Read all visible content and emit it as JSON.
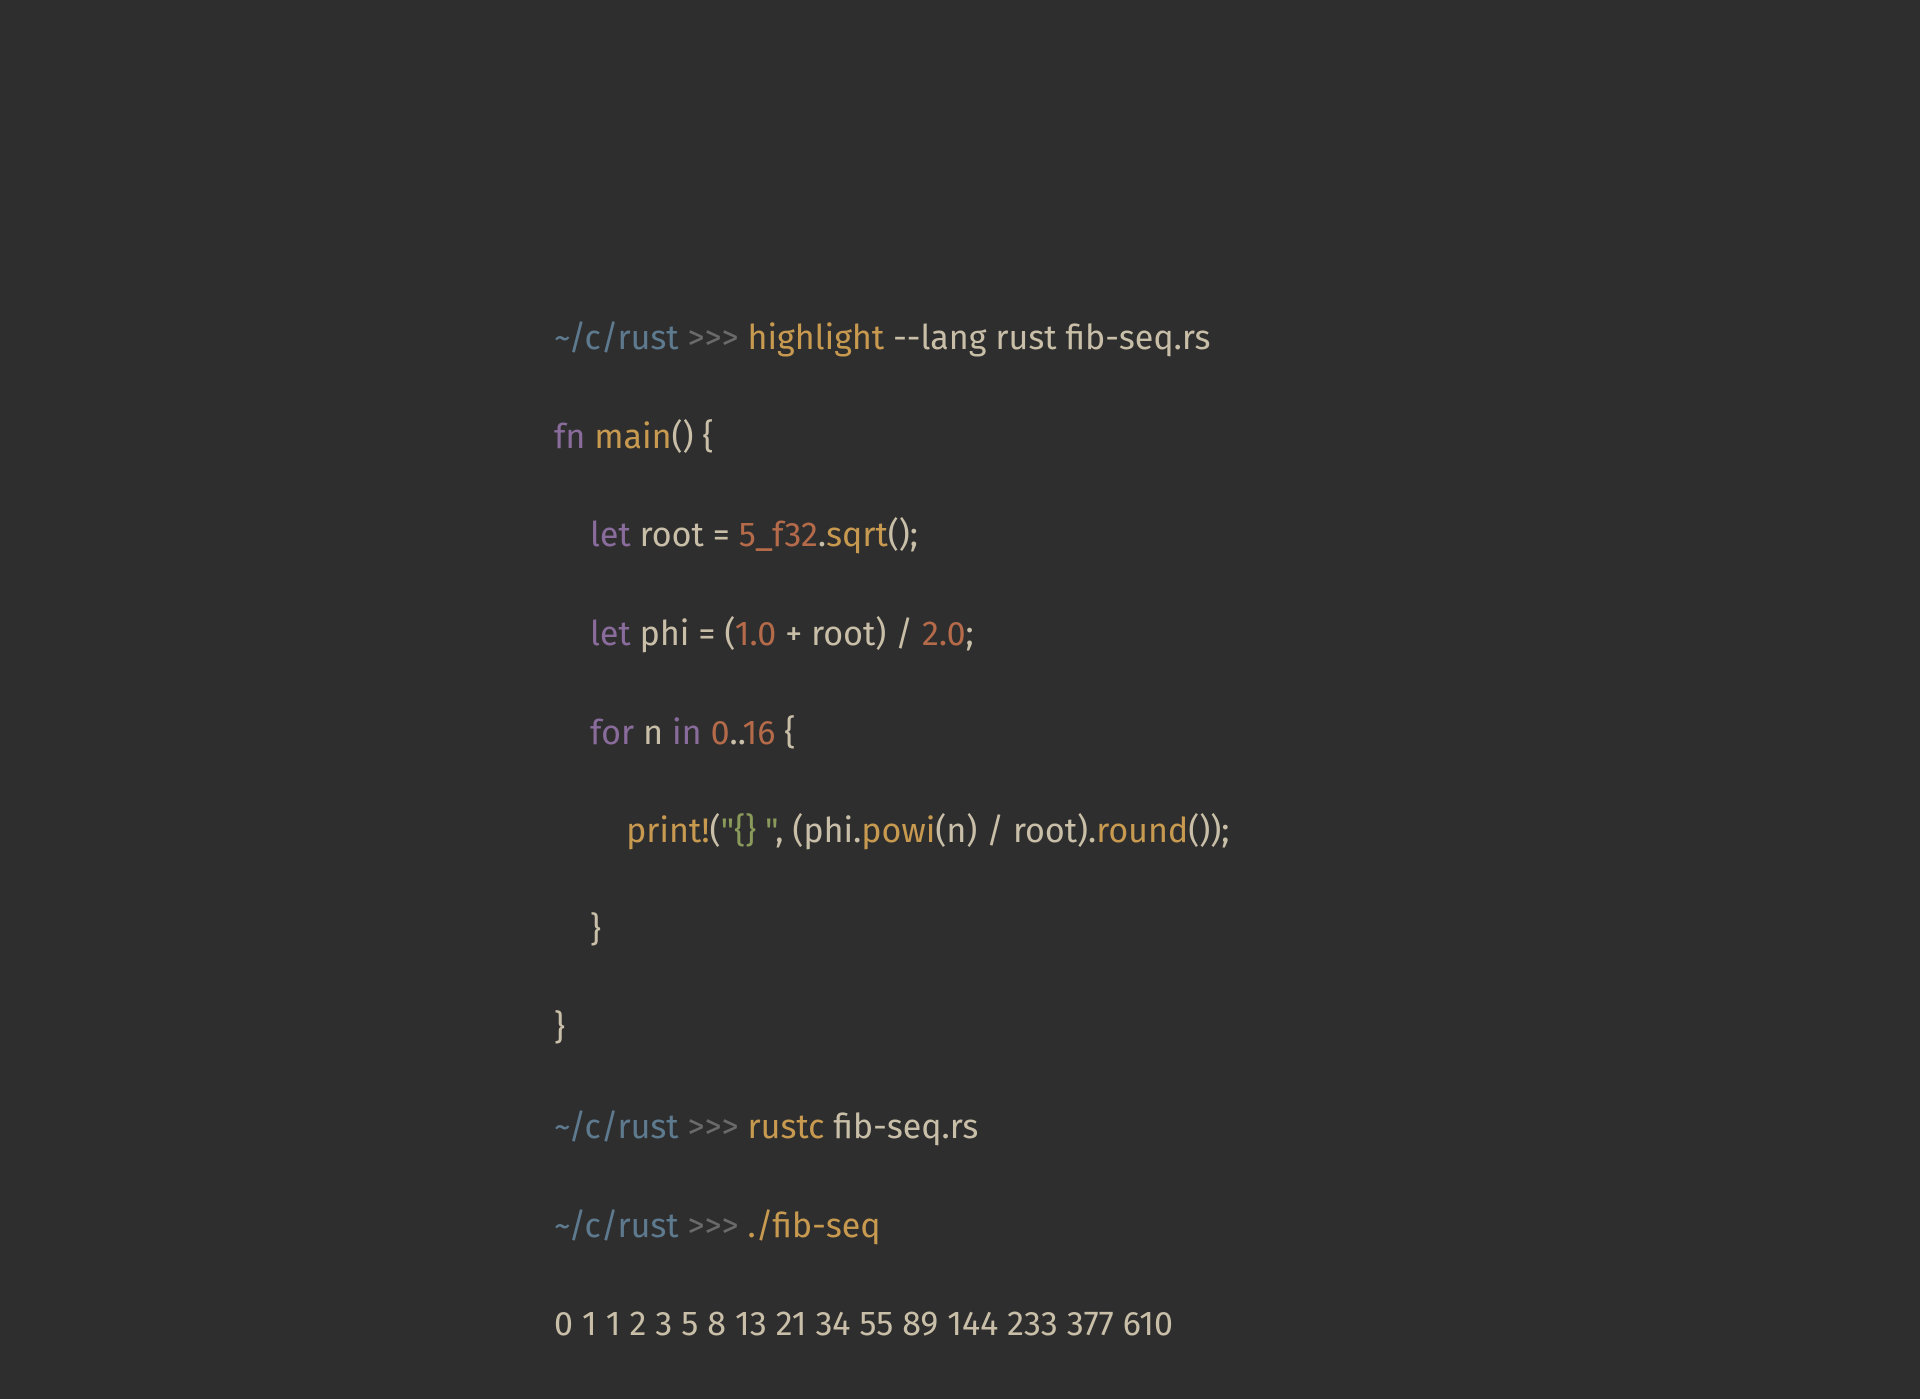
{
  "prompt_path": "~/c/rust",
  "prompt_arrows": ">>>",
  "cmd1_cmd": "highlight",
  "cmd1_args": " --lang rust fib-seq.rs",
  "l1_a": "fn",
  "l1_b": " ",
  "l1_c": "main",
  "l1_d": "() {",
  "l2_a": "    ",
  "l2_b": "let",
  "l2_c": " root = ",
  "l2_d": "5_f32",
  "l2_e": ".",
  "l2_f": "sqrt",
  "l2_g": "();",
  "l3_a": "    ",
  "l3_b": "let",
  "l3_c": " phi = (",
  "l3_d": "1.0",
  "l3_e": " + root) / ",
  "l3_f": "2.0",
  "l3_g": ";",
  "l4_a": "    ",
  "l4_b": "for",
  "l4_c": " n ",
  "l4_d": "in",
  "l4_e": " ",
  "l4_f": "0",
  "l4_g": "..",
  "l4_h": "16",
  "l4_i": " {",
  "l5_a": "        ",
  "l5_b": "print!",
  "l5_c": "(",
  "l5_d": "\"{} \"",
  "l5_e": ", (phi.",
  "l5_f": "powi",
  "l5_g": "(n) / root).",
  "l5_h": "round",
  "l5_i": "());",
  "l6": "    }",
  "l7": "}",
  "cmd2_cmd": "rustc",
  "cmd2_args": " fib-seq.rs",
  "cmd3_cmd": "./fib-seq",
  "output_line": "0 1 1 2 3 5 8 13 21 34 55 89 144 233 377 610"
}
